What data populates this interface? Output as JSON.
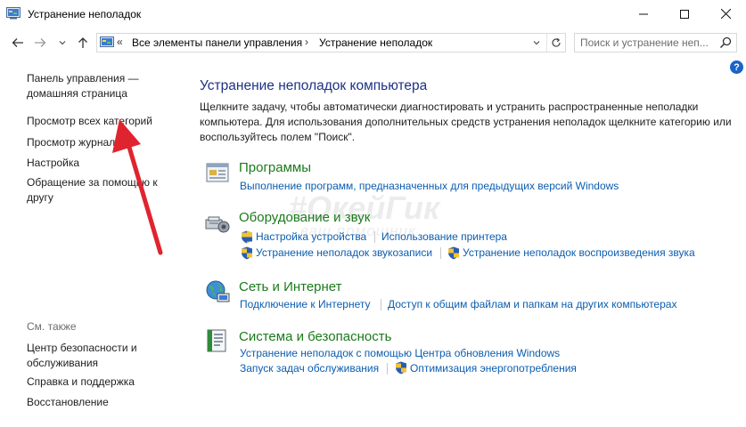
{
  "window": {
    "title": "Устранение неполадок",
    "minimize_glyph": "—",
    "close_glyph": "✕"
  },
  "address_bar": {
    "overflow_chevron": "«",
    "crumbs": [
      "Все элементы панели управления",
      "Устранение неполадок"
    ],
    "separator": "›",
    "search_placeholder": "Поиск и устранение неп..."
  },
  "sidebar": {
    "links": [
      "Панель управления —\nдомашняя страница",
      "Просмотр всех категорий",
      "Просмотр журнала",
      "Настройка",
      "Обращение за помощью к\nдругу"
    ],
    "see_also_label": "См. также",
    "see_also_links": [
      "Центр безопасности и\nобслуживания",
      "Справка и поддержка",
      "Восстановление"
    ]
  },
  "main": {
    "title": "Устранение неполадок компьютера",
    "description": "Щелкните задачу, чтобы автоматически диагностировать и устранить распространенные неполадки компьютера. Для использования дополнительных средств устранения неполадок щелкните категорию или воспользуйтесь полем \"Поиск\".",
    "categories": [
      {
        "title": "Программы",
        "links": [
          "Выполнение программ, предназначенных для предыдущих версий Windows"
        ]
      },
      {
        "title": "Оборудование и звук",
        "links": [
          "Настройка устройства",
          "Использование принтера",
          "Устранение неполадок звукозаписи",
          "Устранение неполадок воспроизведения звука"
        ]
      },
      {
        "title": "Сеть и Интернет",
        "links": [
          "Подключение к Интернету",
          "Доступ к общим файлам и папкам на других компьютерах"
        ]
      },
      {
        "title": "Система и безопасность",
        "links": [
          "Устранение неполадок с помощью Центра обновления Windows",
          "Запуск задач обслуживания",
          "Оптимизация энергопотребления"
        ]
      }
    ]
  },
  "help_glyph": "?",
  "watermark": {
    "text": "#ОкейГик",
    "subtext": "ваш помощник"
  },
  "colors": {
    "category_title": "#1a7a1a",
    "link": "#0b5db0",
    "heading": "#1e3287",
    "annotation_arrow": "#e0242f"
  }
}
